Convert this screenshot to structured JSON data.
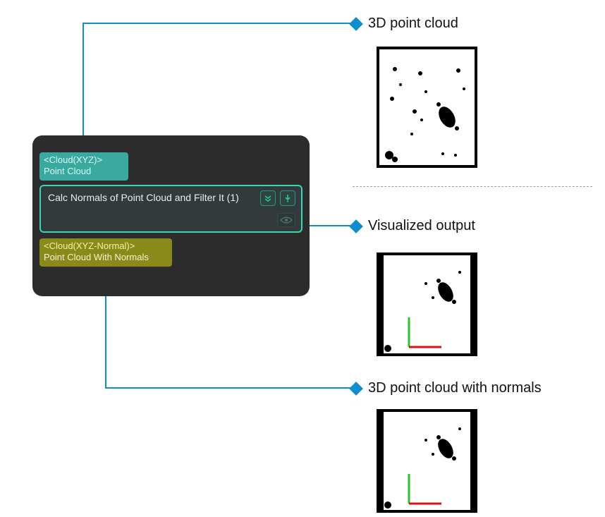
{
  "callouts": {
    "input": "3D point cloud",
    "visualized": "Visualized output",
    "output": "3D point cloud with normals"
  },
  "node": {
    "input_port": {
      "type": "<Cloud(XYZ)>",
      "name": "Point Cloud"
    },
    "title": "Calc Normals of Point Cloud and Filter It (1)",
    "output_port": {
      "type": "<Cloud(XYZ-Normal)>",
      "name": "Point Cloud With Normals"
    }
  }
}
